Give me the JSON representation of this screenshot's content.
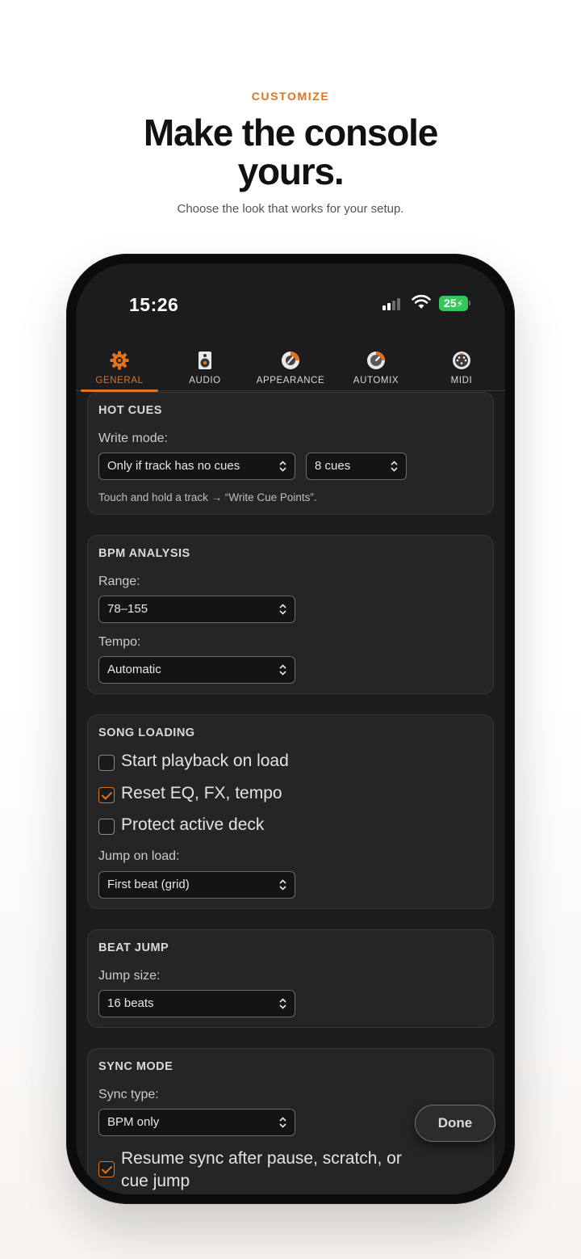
{
  "hero": {
    "kicker": "CUSTOMIZE",
    "headline": "Make the console yours.",
    "subhead": "Choose the look that works for your setup."
  },
  "status": {
    "time": "15:26",
    "battery": "25"
  },
  "tabs": [
    {
      "label": "GENERAL",
      "icon": "gear-icon",
      "active": true
    },
    {
      "label": "AUDIO",
      "icon": "speaker-icon",
      "active": false
    },
    {
      "label": "APPEARANCE",
      "icon": "color-wheel-icon",
      "active": false
    },
    {
      "label": "AUTOMIX",
      "icon": "gauge-icon",
      "active": false
    },
    {
      "label": "MIDI",
      "icon": "midi-connector-icon",
      "active": false
    }
  ],
  "hot_cues": {
    "title": "HOT CUES",
    "write_mode_label": "Write mode:",
    "write_mode_value": "Only if track has no cues",
    "cue_count_value": "8 cues",
    "hint": "Touch and hold a track → “Write Cue Points”."
  },
  "bpm": {
    "title": "BPM ANALYSIS",
    "range_label": "Range:",
    "range_value": "78–155",
    "tempo_label": "Tempo:",
    "tempo_value": "Automatic"
  },
  "song_loading": {
    "title": "SONG LOADING",
    "options": [
      {
        "label": "Start playback on load",
        "checked": false
      },
      {
        "label": "Reset EQ, FX, tempo",
        "checked": true
      },
      {
        "label": "Protect active deck",
        "checked": false
      }
    ],
    "jump_label": "Jump on load:",
    "jump_value": "First beat (grid)"
  },
  "beat_jump": {
    "title": "BEAT JUMP",
    "size_label": "Jump size:",
    "size_value": "16 beats"
  },
  "sync_mode": {
    "title": "SYNC MODE",
    "type_label": "Sync type:",
    "type_value": "BPM only",
    "resume_line1": "Resume sync after pause, scratch, or",
    "resume_line2": "cue jump",
    "resume_checked": true
  },
  "done_label": "Done",
  "colors": {
    "accent": "#e0731f",
    "screen_bg": "#1c1c1e",
    "card_bg": "#252528",
    "battery": "#34c759"
  }
}
